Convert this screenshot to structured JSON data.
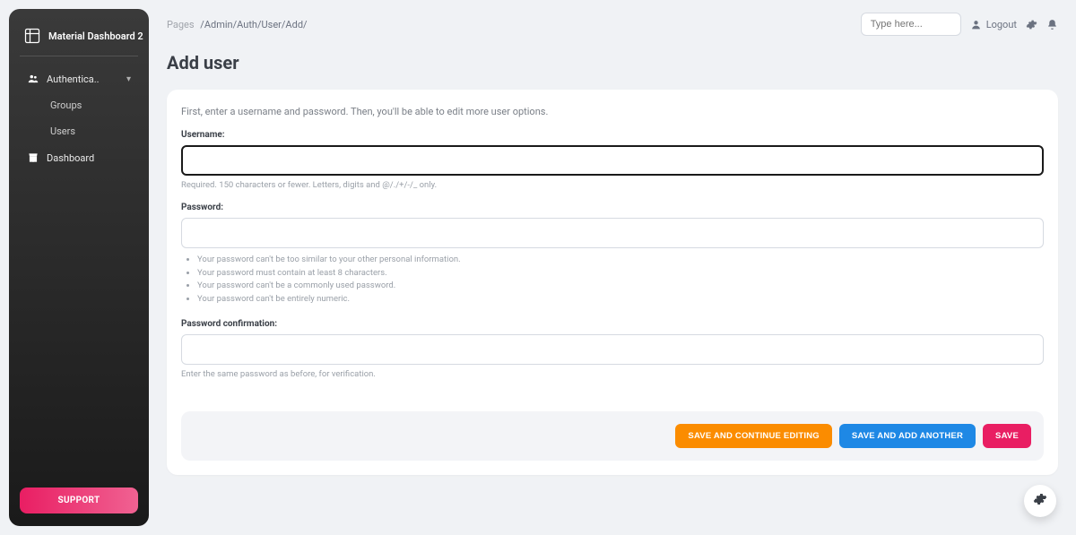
{
  "brand": {
    "title": "Material Dashboard 2"
  },
  "sidebar": {
    "items": [
      {
        "label": "Authentica..",
        "icon": "users-icon"
      },
      {
        "label": "Dashboard",
        "icon": "store-icon"
      }
    ],
    "subitems": [
      {
        "label": "Groups"
      },
      {
        "label": "Users"
      }
    ],
    "support_label": "SUPPORT"
  },
  "breadcrumb": {
    "root": "Pages",
    "path": "/Admin/Auth/User/Add/"
  },
  "header": {
    "search_placeholder": "Type here...",
    "logout_label": "Logout"
  },
  "page": {
    "title": "Add user"
  },
  "form": {
    "intro": "First, enter a username and password. Then, you'll be able to edit more user options.",
    "username_label": "Username:",
    "username_help": "Required. 150 characters or fewer. Letters, digits and @/./+/-/_ only.",
    "password_label": "Password:",
    "password_rules": [
      "Your password can't be too similar to your other personal information.",
      "Your password must contain at least 8 characters.",
      "Your password can't be a commonly used password.",
      "Your password can't be entirely numeric."
    ],
    "password2_label": "Password confirmation:",
    "password2_help": "Enter the same password as before, for verification."
  },
  "actions": {
    "save_continue": "SAVE AND CONTINUE EDITING",
    "save_add_another": "SAVE AND ADD ANOTHER",
    "save": "SAVE"
  }
}
